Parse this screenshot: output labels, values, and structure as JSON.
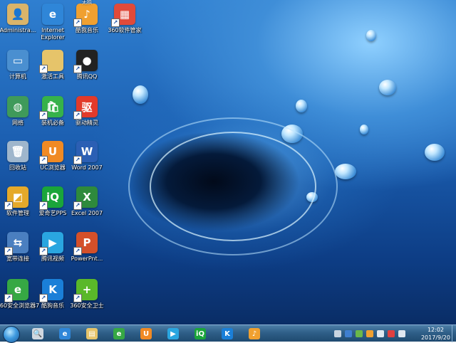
{
  "desktop_icons": [
    {
      "name": "administrator-folder",
      "label": "Administra...",
      "icon": "user-folder-icon",
      "color": "#d9b46a",
      "glyph": "👤"
    },
    {
      "name": "internet-explorer",
      "label": "Internet Explorer",
      "icon": "internet-explorer-icon",
      "color": "#2f86d8",
      "glyph": "e"
    },
    {
      "name": "kugou-music",
      "label": "酷我音乐",
      "icon": "music-box-icon",
      "color": "#f0a030",
      "glyph": "♪",
      "badge": "无损"
    },
    {
      "name": "360-software-manager",
      "label": "360软件管家",
      "icon": "software-manager-icon",
      "color": "#e04a3a",
      "glyph": "▦"
    },
    {
      "name": "computer",
      "label": "计算机",
      "icon": "computer-icon",
      "color": "#4a8fd0",
      "glyph": "▭"
    },
    {
      "name": "activation-tool",
      "label": "激活工具",
      "icon": "folder-icon",
      "color": "#e6c46a",
      "glyph": ""
    },
    {
      "name": "tencent-qq",
      "label": "腾讯QQ",
      "icon": "qq-penguin-icon",
      "color": "#222222",
      "glyph": "●"
    },
    {
      "name": "network",
      "label": "网络",
      "icon": "network-globe-icon",
      "color": "#3f9a5a",
      "glyph": "◍"
    },
    {
      "name": "essential-apps",
      "label": "装机必备",
      "icon": "shopping-bag-icon",
      "color": "#36b24a",
      "glyph": "🛍"
    },
    {
      "name": "driver-wizard",
      "label": "驱动精灵",
      "icon": "driver-icon",
      "color": "#e23a2a",
      "glyph": "驱"
    },
    {
      "name": "recycle-bin",
      "label": "回收站",
      "icon": "recycle-bin-icon",
      "color": "#9fb6cc",
      "glyph": "🗑"
    },
    {
      "name": "uc-browser",
      "label": "UC浏览器",
      "icon": "uc-browser-icon",
      "color": "#f08a24",
      "glyph": "U"
    },
    {
      "name": "word-2007",
      "label": "Word 2007",
      "icon": "word-icon",
      "color": "#2b5fb4",
      "glyph": "W"
    },
    {
      "name": "software-manager",
      "label": "软件管理",
      "icon": "app-manager-icon",
      "color": "#e5a92a",
      "glyph": "◩"
    },
    {
      "name": "iqiyi-pps",
      "label": "爱奇艺PPS",
      "icon": "iqiyi-icon",
      "color": "#1aa53a",
      "glyph": "iQ"
    },
    {
      "name": "excel-2007",
      "label": "Excel 2007",
      "icon": "excel-icon",
      "color": "#2e8a3c",
      "glyph": "X"
    },
    {
      "name": "broadband-connection",
      "label": "宽带连接",
      "icon": "broadband-icon",
      "color": "#4a7fc0",
      "glyph": "⇆"
    },
    {
      "name": "tencent-video",
      "label": "腾讯视频",
      "icon": "tencent-video-icon",
      "color": "#2aa6e0",
      "glyph": "▶"
    },
    {
      "name": "powerpoint",
      "label": "PowerPnt...",
      "icon": "powerpoint-icon",
      "color": "#d4502a",
      "glyph": "P"
    },
    {
      "name": "360-browser",
      "label": "360安全浏览器7",
      "icon": "360-browser-icon",
      "color": "#36a844",
      "glyph": "e"
    },
    {
      "name": "kuwo-music",
      "label": "酷狗音乐",
      "icon": "kugou-icon",
      "color": "#1a7fd8",
      "glyph": "K"
    },
    {
      "name": "360-safeguard",
      "label": "360安全卫士",
      "icon": "360-guard-icon",
      "color": "#5ab82a",
      "glyph": "+"
    }
  ],
  "taskbar": {
    "pinned": [
      {
        "name": "search",
        "icon": "search-icon",
        "color": "#d0d8e0",
        "glyph": "🔍"
      },
      {
        "name": "ie",
        "icon": "internet-explorer-icon",
        "color": "#2f86d8",
        "glyph": "e"
      },
      {
        "name": "explorer",
        "icon": "folder-icon",
        "color": "#e6c46a",
        "glyph": "▤"
      },
      {
        "name": "360-browser",
        "icon": "360-browser-icon",
        "color": "#36a844",
        "glyph": "e"
      },
      {
        "name": "uc-browser",
        "icon": "uc-browser-icon",
        "color": "#f08a24",
        "glyph": "U"
      },
      {
        "name": "tencent-video",
        "icon": "tencent-video-icon",
        "color": "#2aa6e0",
        "glyph": "▶"
      },
      {
        "name": "iqiyi",
        "icon": "iqiyi-icon",
        "color": "#1aa53a",
        "glyph": "iQ"
      },
      {
        "name": "kugou",
        "icon": "kugou-icon",
        "color": "#1a7fd8",
        "glyph": "K"
      },
      {
        "name": "music-box",
        "icon": "music-box-icon",
        "color": "#f0a030",
        "glyph": "♪"
      }
    ],
    "tray": [
      {
        "name": "keyboard",
        "icon": "keyboard-icon",
        "color": "#c8d4e0"
      },
      {
        "name": "help",
        "icon": "help-icon",
        "color": "#3f7fd0"
      },
      {
        "name": "security",
        "icon": "shield-icon",
        "color": "#6ab84a"
      },
      {
        "name": "music",
        "icon": "music-tray-icon",
        "color": "#f0a030"
      },
      {
        "name": "network",
        "icon": "network-tray-icon",
        "color": "#e0e8f0"
      },
      {
        "name": "flag",
        "icon": "flag-tray-icon",
        "color": "#e04040"
      },
      {
        "name": "volume",
        "icon": "volume-icon",
        "color": "#e0e8f0"
      }
    ],
    "clock": {
      "time": "12:02",
      "date": "2017/9/20"
    }
  }
}
